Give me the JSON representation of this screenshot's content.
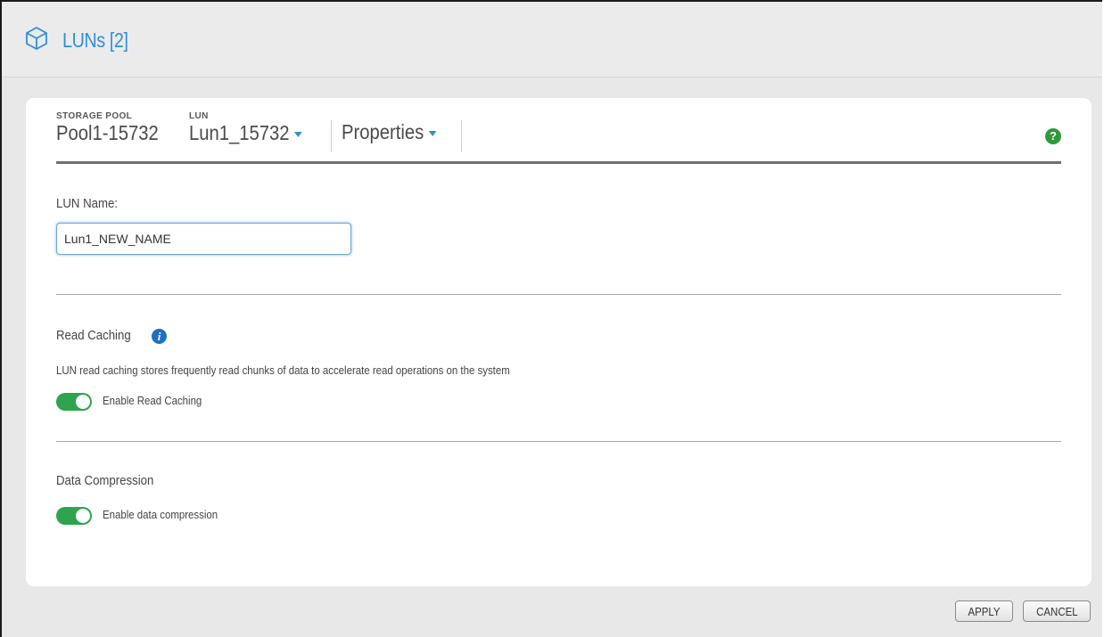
{
  "header": {
    "title": "LUNs [2]",
    "icon": "cube-icon"
  },
  "breadcrumb": {
    "pool_label": "STORAGE POOL",
    "pool_value": "Pool1-15732",
    "lun_label": "LUN",
    "lun_value": "Lun1_15732",
    "view_value": "Properties",
    "help_glyph": "?"
  },
  "lun_name": {
    "label": "LUN Name:",
    "value": "Lun1_NEW_NAME"
  },
  "read_caching": {
    "heading": "Read Caching",
    "info_glyph": "i",
    "description": "LUN read caching stores frequently read chunks of data to accelerate read operations on the system",
    "toggle_label": "Enable Read Caching",
    "enabled": true
  },
  "data_compression": {
    "heading": "Data Compression",
    "toggle_label": "Enable data compression",
    "enabled": true
  },
  "actions": {
    "apply_label": "APPLY",
    "cancel_label": "CANCEL"
  },
  "colors": {
    "accent": "#2f8fd4",
    "toggle_on": "#2ea44f",
    "help": "#2e9a3c",
    "info": "#1f6fc3"
  }
}
